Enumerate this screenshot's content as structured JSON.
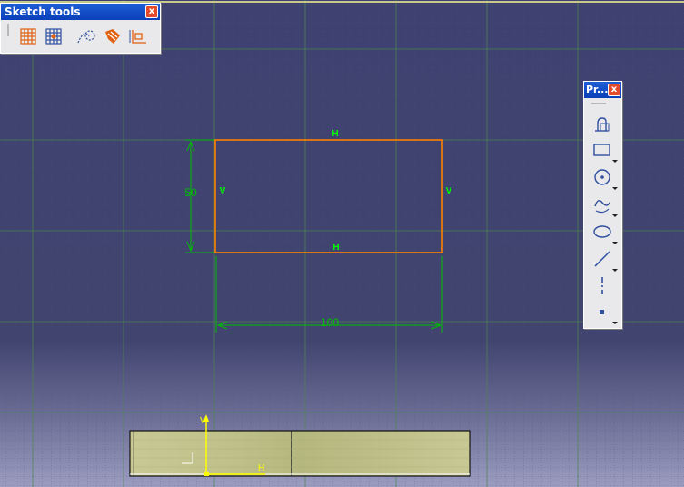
{
  "sketch_tools": {
    "title": "Sketch tools",
    "close_label": "x",
    "buttons": [
      {
        "name": "grid-icon"
      },
      {
        "name": "snap-to-point-icon"
      },
      {
        "name": "construction-geometry-icon"
      },
      {
        "name": "geometrical-constraints-icon"
      },
      {
        "name": "dimensional-constraints-icon"
      }
    ]
  },
  "profile_toolbar": {
    "title": "Pr...",
    "close_label": "x",
    "buttons": [
      {
        "name": "profile-icon"
      },
      {
        "name": "rectangle-icon"
      },
      {
        "name": "circle-icon"
      },
      {
        "name": "spline-icon"
      },
      {
        "name": "ellipse-icon"
      },
      {
        "name": "line-icon"
      },
      {
        "name": "axis-icon"
      },
      {
        "name": "point-icon"
      }
    ]
  },
  "sketch": {
    "constraint_top": "H",
    "constraint_bottom": "H",
    "constraint_left": "V",
    "constraint_right": "V",
    "dimension_height": "50",
    "dimension_width": "100",
    "profile_color": "#ff8000",
    "dimension_color": "#00c000",
    "constraint_color": "#00ff00"
  },
  "axis": {
    "h_label": "H",
    "v_label": "V",
    "axis_color": "#ffff00"
  }
}
